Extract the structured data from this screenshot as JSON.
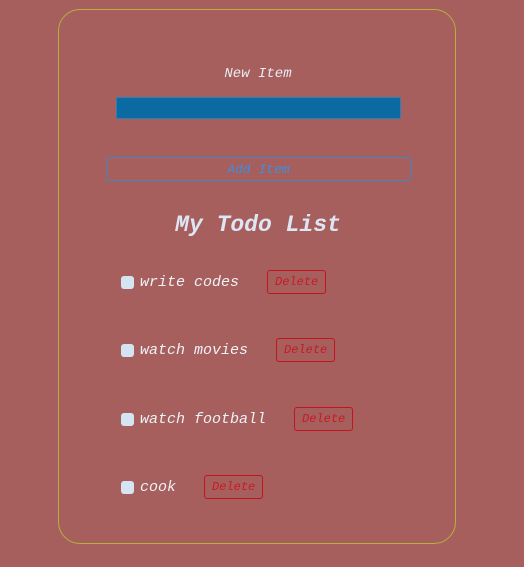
{
  "form": {
    "label": "New Item",
    "input_value": "",
    "add_label": "Add Item"
  },
  "list": {
    "title": "My Todo List",
    "items": [
      {
        "text": "write codes",
        "checked": false,
        "delete_label": "Delete"
      },
      {
        "text": "watch movies",
        "checked": false,
        "delete_label": "Delete"
      },
      {
        "text": "watch football",
        "checked": false,
        "delete_label": "Delete"
      },
      {
        "text": "cook",
        "checked": false,
        "delete_label": "Delete"
      }
    ]
  },
  "colors": {
    "background": "#a65f5c",
    "card_border": "#b7b13a",
    "input_fill": "#0a6aa1",
    "add_button": "#3d8ee3",
    "delete_button": "#c81a24"
  }
}
